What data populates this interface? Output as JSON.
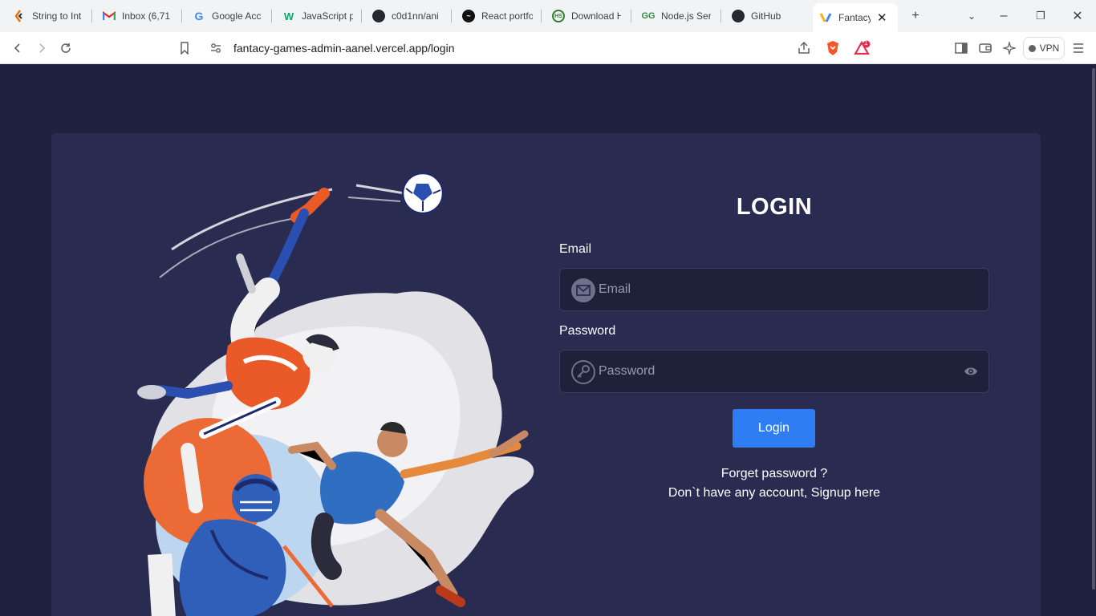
{
  "browser": {
    "tabs": [
      {
        "title": "String to Int",
        "icon": "codepen-icon"
      },
      {
        "title": "Inbox (6,71",
        "icon": "gmail-icon"
      },
      {
        "title": "Google Acc",
        "icon": "google-icon"
      },
      {
        "title": "JavaScript p",
        "icon": "w3-icon"
      },
      {
        "title": "c0d1nn/ani",
        "icon": "github-icon"
      },
      {
        "title": "React portfo",
        "icon": "react-icon"
      },
      {
        "title": "Download H",
        "icon": "download-icon"
      },
      {
        "title": "Node.js Ser",
        "icon": "gfg-icon"
      },
      {
        "title": "GitHub",
        "icon": "github-icon"
      },
      {
        "title": "Fantacy",
        "icon": "fantacy-icon"
      }
    ],
    "url": "fantacy-games-admin-aanel.vercel.app/login",
    "vpn_label": "VPN",
    "notification_count": "1"
  },
  "login": {
    "title": "LOGIN",
    "email_label": "Email",
    "email_placeholder": "Email",
    "password_label": "Password",
    "password_placeholder": "Password",
    "submit_label": "Login",
    "forgot_label": "Forget password ?",
    "signup_label": "Don`t have any account, Signup here"
  },
  "colors": {
    "page_bg": "#20213f",
    "card_bg": "#2a2b51",
    "input_bg": "#1f2039",
    "accent": "#2e7df2"
  }
}
